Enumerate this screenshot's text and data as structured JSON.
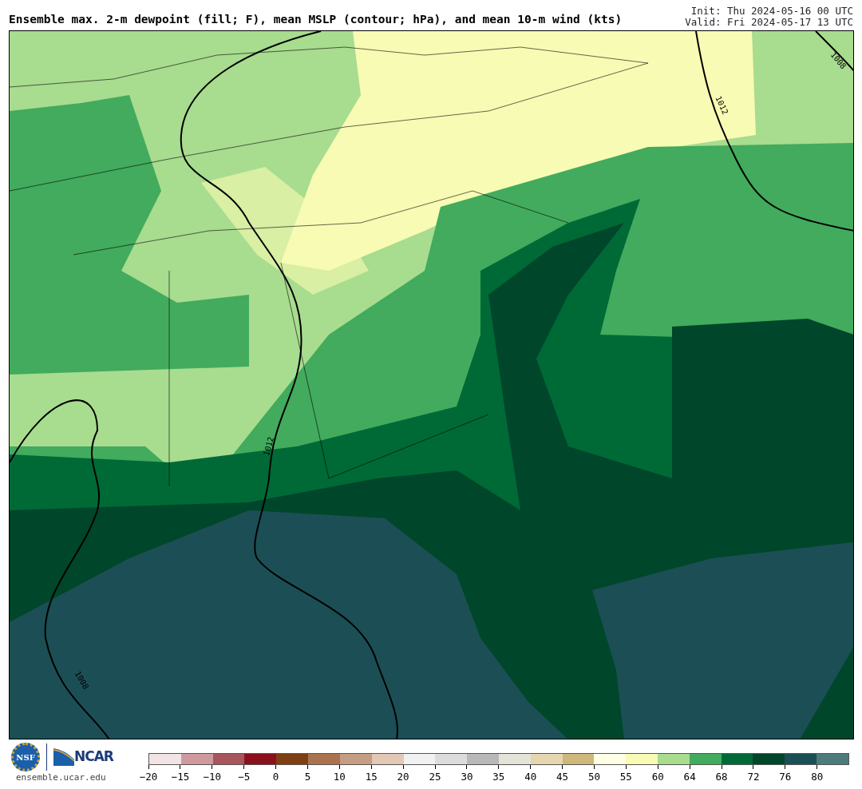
{
  "title": "Ensemble max. 2-m dewpoint (fill; F), mean MSLP (contour; hPa), and mean 10-m wind (kts)",
  "init": "Init: Thu 2024-05-16 00 UTC",
  "valid": "Valid: Fri 2024-05-17 13 UTC",
  "map": {
    "contour_labels": [
      {
        "text": "1012"
      },
      {
        "text": "1012"
      },
      {
        "text": "1008"
      },
      {
        "text": "1008"
      }
    ]
  },
  "footer": {
    "nsf_logo_text": "NSF",
    "ncar_logo_text": "NCAR",
    "site": "ensemble.ucar.edu"
  },
  "colorbar": {
    "bins": [
      {
        "color": "#f2e4e4"
      },
      {
        "color": "#cf9a9e"
      },
      {
        "color": "#a8555d"
      },
      {
        "color": "#8a111c"
      },
      {
        "color": "#7f3f12"
      },
      {
        "color": "#a8734e"
      },
      {
        "color": "#c49d82"
      },
      {
        "color": "#e2c8b5"
      },
      {
        "color": "#f1f1f1"
      },
      {
        "color": "#dcdcdc"
      },
      {
        "color": "#b8b8b8"
      },
      {
        "color": "#e5e2d8"
      },
      {
        "color": "#e6d6b0"
      },
      {
        "color": "#cdb77a"
      },
      {
        "color": "#fefee6"
      },
      {
        "color": "#f8fbb3"
      },
      {
        "color": "#a8dc8f"
      },
      {
        "color": "#42ab5d"
      },
      {
        "color": "#006a36"
      },
      {
        "color": "#00462a"
      },
      {
        "color": "#1b4f55"
      },
      {
        "color": "#4e7a7b"
      }
    ],
    "ticks": [
      "−20",
      "−15",
      "−10",
      "−5",
      "0",
      "5",
      "10",
      "15",
      "20",
      "25",
      "30",
      "35",
      "40",
      "45",
      "50",
      "55",
      "60",
      "64",
      "68",
      "72",
      "76",
      "80"
    ]
  }
}
